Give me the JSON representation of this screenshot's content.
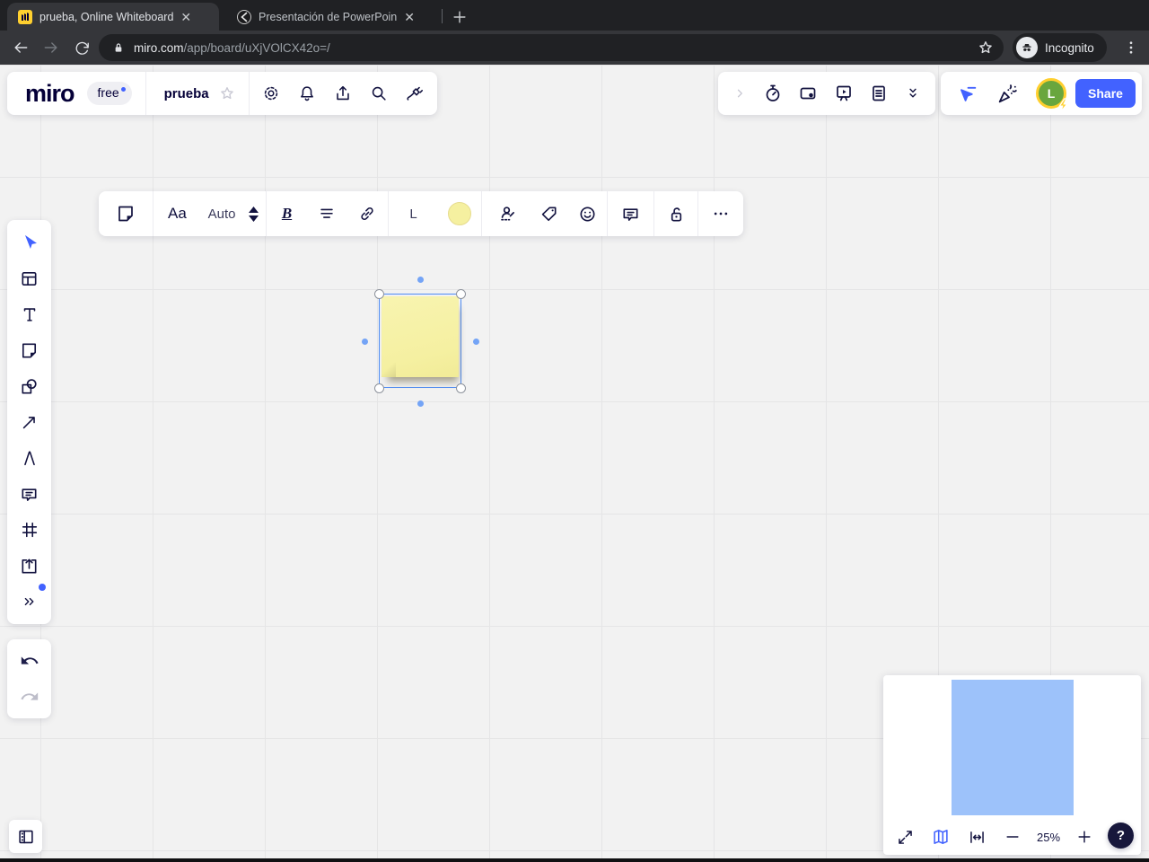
{
  "browser": {
    "tabs": [
      {
        "title": "prueba, Online Whiteboard",
        "icon": "miro-favicon"
      },
      {
        "title": "Presentación de PowerPoin",
        "icon": "globe-favicon"
      }
    ],
    "new_tab": "+",
    "url": {
      "host": "miro.com",
      "path": "/app/board/uXjVOlCX42o=/"
    },
    "incognito_label": "Incognito"
  },
  "app_header": {
    "logo": "miro",
    "plan_badge": "free",
    "board_title": "prueba",
    "left_icons": [
      "star-icon",
      "settings-gear-icon",
      "notifications-bell-icon",
      "export-icon",
      "search-icon",
      "apps-plug-icon"
    ],
    "right_icons": [
      "collapse-chevron-icon",
      "timer-icon",
      "video-icon",
      "presentation-icon",
      "notes-icon",
      "more-tools-chevrons-icon",
      "follow-cursor-icon",
      "reactions-confetti-icon"
    ],
    "avatar_initial": "L",
    "share_label": "Share"
  },
  "context_toolbar": {
    "icons": [
      "sticky-note-icon",
      "font-style-icon",
      "font-size-stepper-icon",
      "bold-icon",
      "align-icon",
      "link-icon",
      "color-swatch-icon",
      "assign-icon",
      "tag-icon",
      "emoji-icon",
      "comment-icon",
      "unlock-icon",
      "more-icon"
    ],
    "font_style_label": "Aa",
    "font_size_value": "Auto",
    "bold_label": "B",
    "size_label": "L"
  },
  "left_toolbar": {
    "icons": [
      "select-cursor-icon",
      "templates-icon",
      "text-icon",
      "sticky-note-icon",
      "shapes-icon",
      "connector-arrow-icon",
      "pen-icon",
      "comment-icon",
      "frame-icon",
      "upload-icon",
      "more-tools-icon",
      "undo-icon",
      "redo-icon"
    ]
  },
  "canvas": {
    "selection": {
      "object": "sticky-note",
      "color": "#F5F0A1"
    }
  },
  "bottom_bar": {
    "panel_toggle_icon": "frames-panel-icon",
    "minimap_icons": [
      "expand-icon",
      "map-icon",
      "fit-width-icon",
      "zoom-out-icon",
      "zoom-in-icon"
    ],
    "zoom_level": "25%",
    "help_label": "?"
  },
  "colors": {
    "accent_blue": "#4262FF",
    "selection_blue": "#4E8CF5",
    "sticky_yellow": "#F5F0A1",
    "avatar_green": "#69A63E",
    "avatar_ring": "#FFCF2E",
    "navy": "#12123F",
    "canvas_bg": "#F2F2F2"
  }
}
